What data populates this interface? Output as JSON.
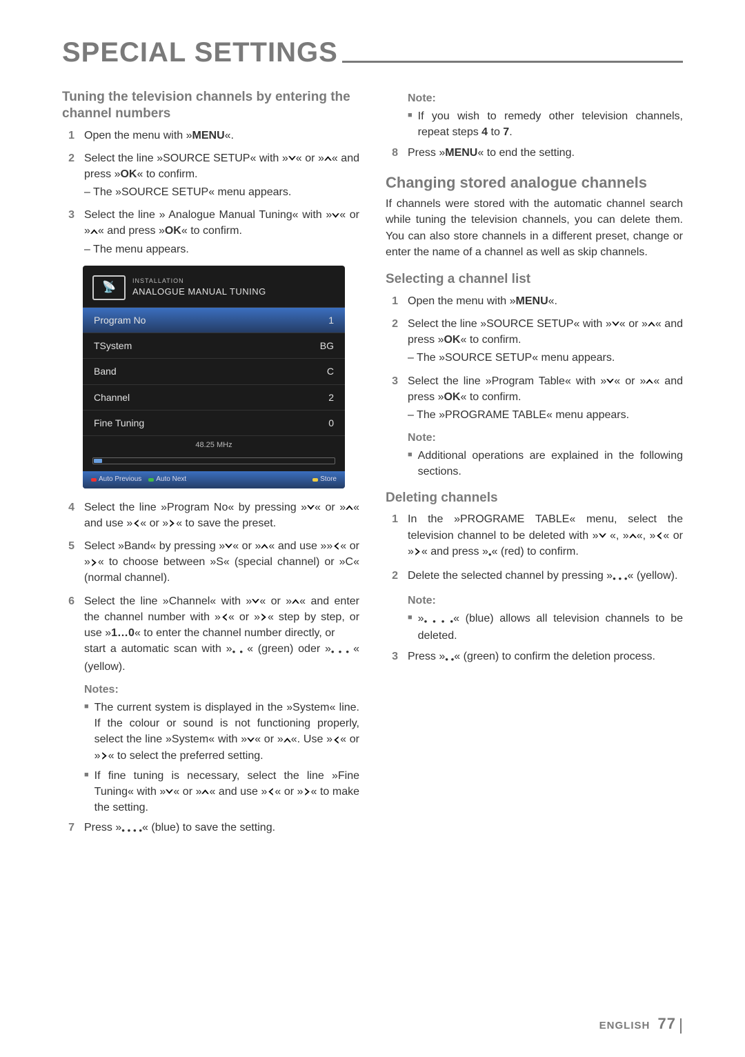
{
  "title": "SPECIAL SETTINGS",
  "left": {
    "h1": "Tuning the television channels by entering the channel numbers",
    "s1": "Open the menu with »MENU«.",
    "s2a": "Select the line »SOURCE SETUP« with »",
    "s2b": "« or »",
    "s2c": "« and press »OK« to confirm.",
    "s2d": "– The »SOURCE SETUP« menu appears.",
    "s3a": "Select the line » Analogue Manual Tuning« with »",
    "s3b": "« or »",
    "s3c": "« and press »OK« to confirm.",
    "s3d": "– The menu appears.",
    "panel": {
      "sup": "INSTALLATION",
      "title": "ANALOGUE MANUAL TUNING",
      "rows": [
        {
          "l": "Program No",
          "v": "1"
        },
        {
          "l": "TSystem",
          "v": "BG"
        },
        {
          "l": "Band",
          "v": "C"
        },
        {
          "l": "Channel",
          "v": "2"
        },
        {
          "l": "Fine Tuning",
          "v": "0"
        }
      ],
      "freq": "48.25 MHz",
      "btns": [
        {
          "c": "#e33",
          "t": "Auto Previous"
        },
        {
          "c": "#4b4",
          "t": "Auto Next"
        },
        {
          "c": "#ec4",
          "t": "Store"
        }
      ]
    },
    "s4a": "Select the line »Program No« by pressing »",
    "s4b": "« or »",
    "s4c": "« and use »",
    "s4d": "« or »",
    "s4e": "« to save the preset.",
    "s5a": "Select »Band« by pressing »",
    "s5b": "« or »",
    "s5c": "« and use »»",
    "s5d": "« or »",
    "s5e": "«  to choose between »S« (special channel) or »C« (normal channel).",
    "s6a": "Select the line »Channel« with »",
    "s6b": "« or »",
    "s6c": "« and enter the channel number with »",
    "s6d": "« or »",
    "s6e": "« step by step, or use »1…0« to enter the channel number directly, or",
    "s6f": "start a automatic scan with »",
    "s6g": "« (green) oder »",
    "s6h": "« (yellow).",
    "notesH": "Notes:",
    "n1a": "The current system is displayed in the »System« line. If the colour or sound is not functioning properly, select the line »System« with »",
    "n1b": "« or »",
    "n1c": "«. Use »",
    "n1d": "« or »",
    "n1e": "« to select the preferred setting.",
    "n2a": "If fine tuning is necessary, select the line »Fine Tuning« with »",
    "n2b": "« or »",
    "n2c": "« and use »",
    "n2d": "« or »",
    "n2e": "« to make the setting.",
    "s7": "Press »",
    "s7b": "« (blue) to save the setting."
  },
  "right": {
    "noteH1": "Note:",
    "n1a": "If you wish to remedy other television channels, repeat steps 4 to 7.",
    "s8": "Press »MENU« to end the setting.",
    "h2": "Changing stored analogue channels",
    "p1": "If channels were stored with the automatic channel search while tuning the television channels, you can delete them. You can also store channels in a different preset, change or enter the name of a channel as well as skip channels.",
    "h3": "Selecting a channel list",
    "cl1": "Open the menu with »MENU«.",
    "cl2a": "Select the line »SOURCE SETUP« with »",
    "cl2b": "« or »",
    "cl2c": "« and press »OK« to confirm.",
    "cl2d": "– The »SOURCE SETUP« menu appears.",
    "cl3a": "Select the line »Program Table« with »",
    "cl3b": "« or »",
    "cl3c": "« and press »OK« to confirm.",
    "cl3d": "– The »PROGRAME TABLE« menu appears.",
    "noteH2": "Note:",
    "n2": "Additional operations are explained in the following sections.",
    "h4": "Deleting channels",
    "d1a": "In the »PROGRAME TABLE« menu, select the television channel to be deleted with »",
    "d1b": " «, »",
    "d1c": "«, »",
    "d1d": "« or »",
    "d1e": "« and press »",
    "d1f": "« (red) to confirm.",
    "d2a": "Delete the selected channel by pressing »",
    "d2b": "« (yellow).",
    "noteH3": "Note:",
    "n3a": "»",
    "n3b": "« (blue) allows all television channels to be deleted.",
    "d3a": "Press »",
    "d3b": "« (green) to confirm the deletion process."
  },
  "footer": {
    "lang": "ENGLISH",
    "pg": "77"
  }
}
